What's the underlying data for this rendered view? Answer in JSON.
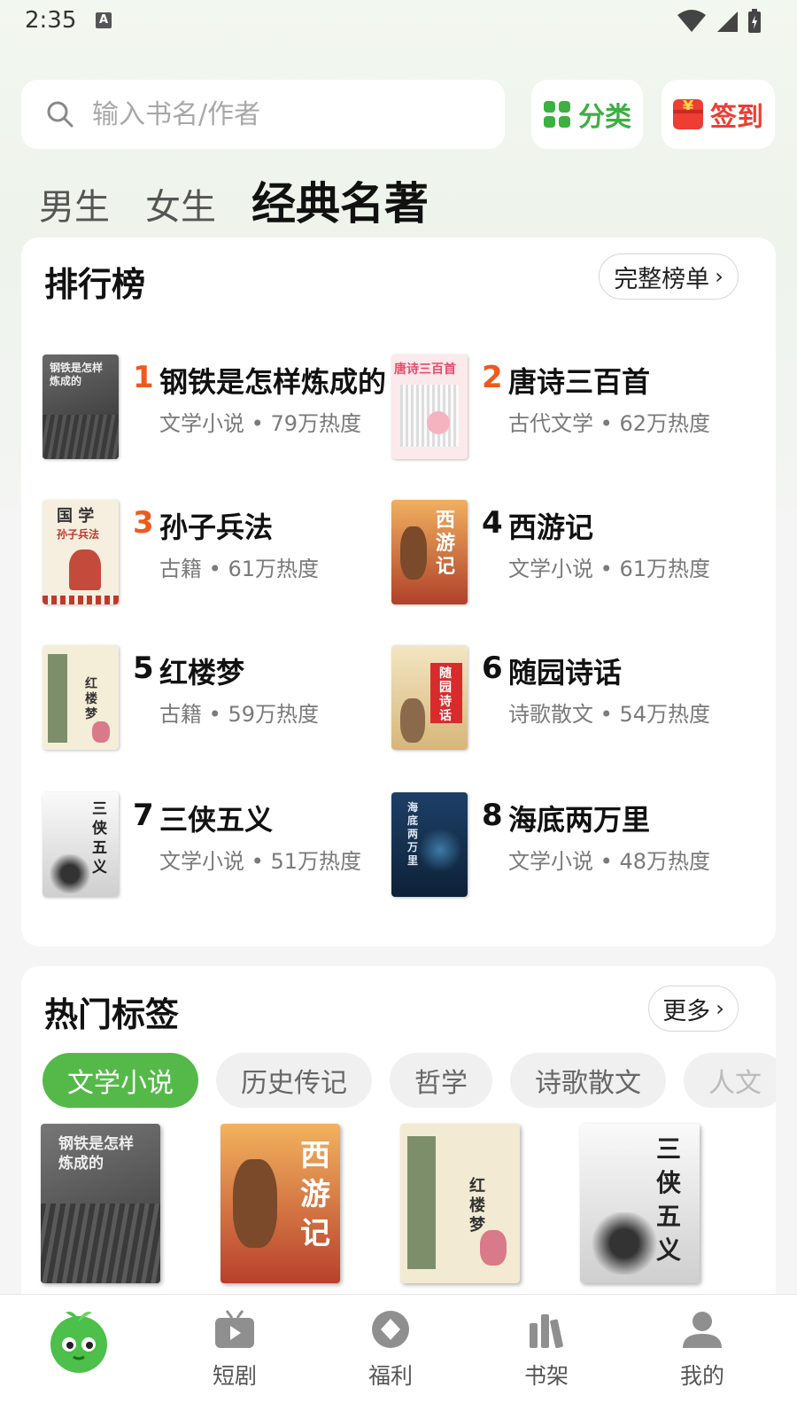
{
  "status_bar": {
    "time": "2:35",
    "a_badge": "A"
  },
  "search": {
    "placeholder": "输入书名/作者"
  },
  "top_buttons": {
    "category": "分类",
    "checkin": "签到",
    "checkin_badge": "¥"
  },
  "tabs": [
    {
      "label": "男生",
      "active": false
    },
    {
      "label": "女生",
      "active": false
    },
    {
      "label": "经典名著",
      "active": true
    }
  ],
  "ranking": {
    "title": "排行榜",
    "full_list": "完整榜单",
    "items": [
      {
        "rank": "1",
        "title": "钢铁是怎样炼成的",
        "category": "文学小说",
        "heat": "79万热度",
        "cover_text": "钢铁是怎样炼成的"
      },
      {
        "rank": "2",
        "title": "唐诗三百首",
        "category": "古代文学",
        "heat": "62万热度",
        "cover_text": "唐诗三百首"
      },
      {
        "rank": "3",
        "title": "孙子兵法",
        "category": "古籍",
        "heat": "61万热度",
        "cover_text": "国 学",
        "cover_sub": "孙子兵法"
      },
      {
        "rank": "4",
        "title": "西游记",
        "category": "文学小说",
        "heat": "61万热度",
        "cover_text": "西游记"
      },
      {
        "rank": "5",
        "title": "红楼梦",
        "category": "古籍",
        "heat": "59万热度",
        "cover_text": "红楼梦"
      },
      {
        "rank": "6",
        "title": "随园诗话",
        "category": "诗歌散文",
        "heat": "54万热度",
        "cover_text": "随园诗话"
      },
      {
        "rank": "7",
        "title": "三侠五义",
        "category": "文学小说",
        "heat": "51万热度",
        "cover_text": "三侠五义"
      },
      {
        "rank": "8",
        "title": "海底两万里",
        "category": "文学小说",
        "heat": "48万热度",
        "cover_text": "海底两万里"
      }
    ],
    "separator": "•"
  },
  "hot_tags": {
    "title": "热门标签",
    "more": "更多",
    "chips": [
      "文学小说",
      "历史传记",
      "哲学",
      "诗歌散文",
      "人文"
    ],
    "books": [
      {
        "cover_text": "钢铁是怎样炼成的"
      },
      {
        "cover_text": "西游记"
      },
      {
        "cover_text": "红楼梦"
      },
      {
        "cover_text": "三侠五义"
      }
    ]
  },
  "bottom_nav": [
    {
      "label": "",
      "icon": "mascot-icon"
    },
    {
      "label": "短剧",
      "icon": "tv-play-icon"
    },
    {
      "label": "福利",
      "icon": "diamond-coin-icon"
    },
    {
      "label": "书架",
      "icon": "bookshelf-icon"
    },
    {
      "label": "我的",
      "icon": "user-icon"
    }
  ],
  "colors": {
    "accent_green": "#55b94a",
    "accent_red": "#ee3d33",
    "rank_orange": "#f05a1e"
  }
}
